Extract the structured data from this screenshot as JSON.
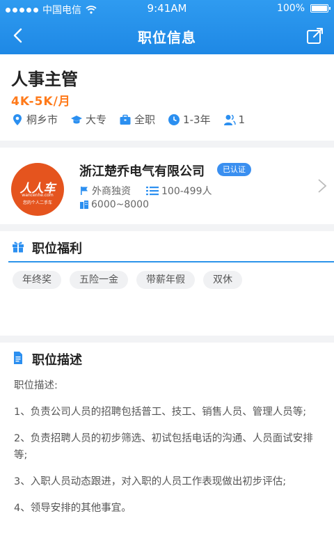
{
  "status_bar": {
    "carrier": "中国电信",
    "time": "9:41AM",
    "battery": "100%"
  },
  "nav": {
    "title": "职位信息"
  },
  "job": {
    "title": "人事主管",
    "salary": "4K-5K/月",
    "tags": {
      "city": "桐乡市",
      "education": "大专",
      "type": "全职",
      "experience": "1-3年",
      "headcount": "1"
    }
  },
  "company": {
    "name": "浙江楚乔电气有限公司",
    "verified": "已认证",
    "nature": "外商独资",
    "size": "100-499人",
    "salary_range": "6000~8000",
    "logo_text": "人人车",
    "logo_sub": "wancenhe.com",
    "logo_tagline": "您的个人二手车"
  },
  "benefits": {
    "heading": "职位福利",
    "items": [
      "年终奖",
      "五险一金",
      "带薪年假",
      "双休"
    ]
  },
  "description": {
    "heading": "职位描述",
    "intro": "职位描述:",
    "points": [
      "1、负责公司人员的招聘包括普工、技工、销售人员、管理人员等;",
      "2、负责招聘人员的初步筛选、初试包括电话的沟通、人员面试安排等;",
      "3、入职人员动态跟进，对入职的人员工作表现做出初步评估;",
      "4、领导安排的其他事宜。"
    ]
  },
  "colors": {
    "primary": "#1e88e5",
    "salary": "#ff7a1a",
    "logo": "#e5541e"
  }
}
